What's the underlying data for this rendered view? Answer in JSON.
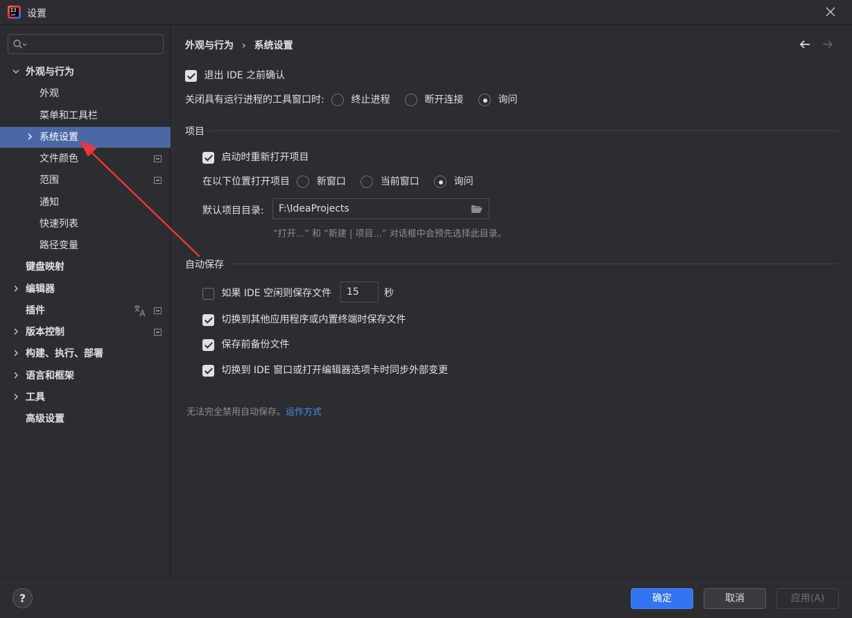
{
  "window": {
    "title": "设置",
    "app_icon_text": "IJ",
    "close_icon": "close-icon"
  },
  "sidebar": {
    "search_placeholder": "",
    "items": [
      {
        "label": "外观与行为",
        "bold": true,
        "expandable": true,
        "expanded": true,
        "level": 0
      },
      {
        "label": "外观",
        "level": 1
      },
      {
        "label": "菜单和工具栏",
        "level": 1
      },
      {
        "label": "系统设置",
        "level": 1,
        "expandable": true,
        "selected": true
      },
      {
        "label": "文件颜色",
        "level": 1,
        "marker": true
      },
      {
        "label": "范围",
        "level": 1,
        "marker": true
      },
      {
        "label": "通知",
        "level": 1
      },
      {
        "label": "快速列表",
        "level": 1
      },
      {
        "label": "路径变量",
        "level": 1
      },
      {
        "label": "键盘映射",
        "bold": true,
        "level": 0
      },
      {
        "label": "编辑器",
        "bold": true,
        "expandable": true,
        "level": 0
      },
      {
        "label": "插件",
        "bold": true,
        "level": 0,
        "marker": true,
        "translate_icon": true
      },
      {
        "label": "版本控制",
        "bold": true,
        "expandable": true,
        "level": 0,
        "marker": true
      },
      {
        "label": "构建、执行、部署",
        "bold": true,
        "expandable": true,
        "level": 0
      },
      {
        "label": "语言和框架",
        "bold": true,
        "expandable": true,
        "level": 0
      },
      {
        "label": "工具",
        "bold": true,
        "expandable": true,
        "level": 0
      },
      {
        "label": "高级设置",
        "bold": true,
        "level": 0
      }
    ]
  },
  "breadcrumb": {
    "parent": "外观与行为",
    "separator": "›",
    "current": "系统设置"
  },
  "general": {
    "confirm_exit_label": "退出 IDE 之前确认",
    "confirm_exit_checked": true,
    "close_tool_window_label": "关闭具有运行进程的工具窗口时:",
    "close_options": [
      "终止进程",
      "断开连接",
      "询问"
    ],
    "close_selected": 2
  },
  "project": {
    "section_title": "项目",
    "reopen_label": "启动时重新打开项目",
    "reopen_checked": true,
    "open_in_label": "在以下位置打开项目",
    "open_options": [
      "新窗口",
      "当前窗口",
      "询问"
    ],
    "open_selected": 2,
    "default_dir_label": "默认项目目录:",
    "default_dir_value": "F:\\IdeaProjects",
    "default_dir_hint": "“打开...” 和 “新建 | 项目...” 对话框中会预先选择此目录。"
  },
  "autosave": {
    "section_title": "自动保存",
    "idle_label": "如果 IDE 空闲则保存文件",
    "idle_checked": false,
    "idle_value": "15",
    "idle_unit": "秒",
    "switch_app_label": "切换到其他应用程序或内置终端时保存文件",
    "switch_app_checked": true,
    "backup_label": "保存前备份文件",
    "backup_checked": true,
    "sync_label": "切换到 IDE 窗口或打开编辑器选项卡时同步外部变更",
    "sync_checked": true,
    "note_text": "无法完全禁用自动保存。",
    "note_link": "运作方式"
  },
  "footer": {
    "help_label": "?",
    "ok_label": "确定",
    "cancel_label": "取消",
    "apply_label": "应用(A)"
  },
  "colors": {
    "selection": "#4a68a6",
    "primary_button": "#3574f0",
    "link": "#548af7",
    "annotation_arrow": "#e8383d"
  }
}
